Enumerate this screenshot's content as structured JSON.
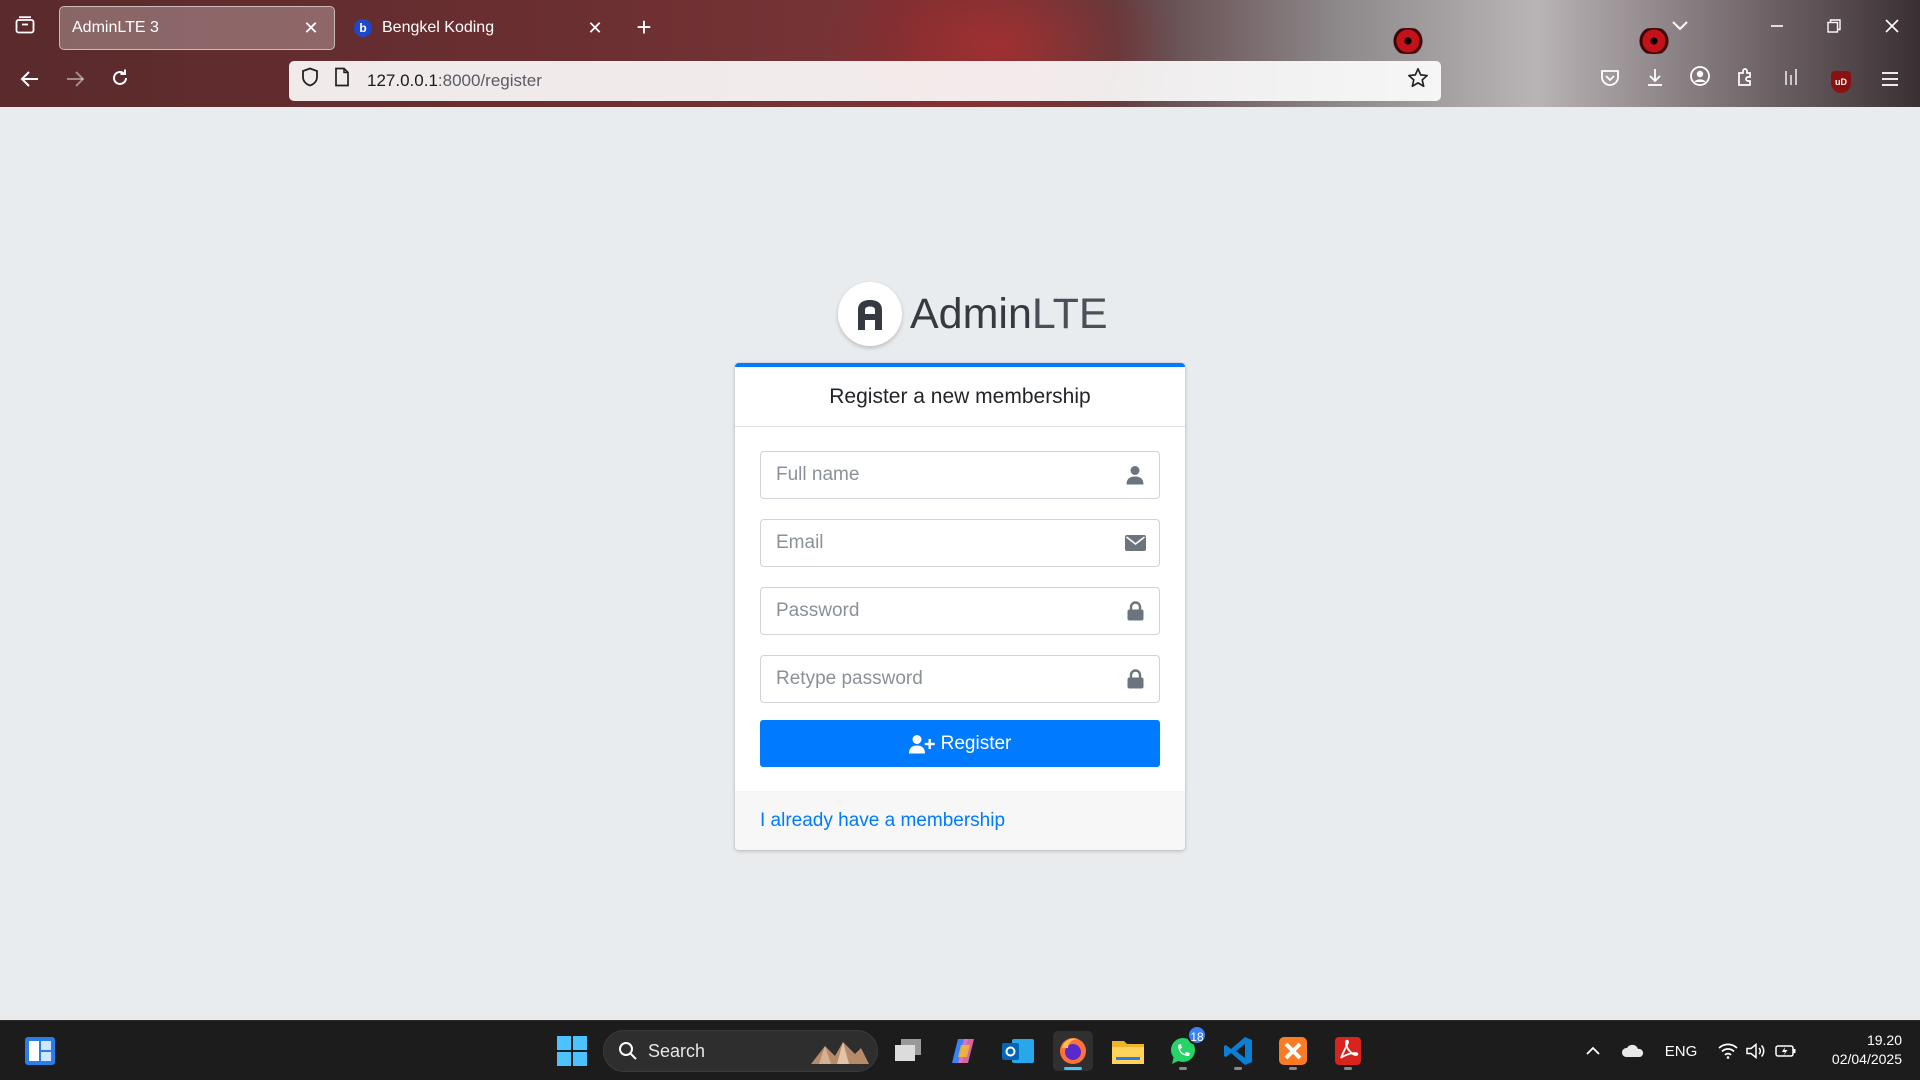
{
  "browser": {
    "tabs": [
      {
        "label": "AdminLTE 3",
        "active": true
      },
      {
        "label": "Bengkel Koding",
        "active": false,
        "favicon": "b"
      }
    ],
    "url_host": "127.0.0.1",
    "url_rest": ":8000/register",
    "icons": {
      "tab_list": "tab-list-icon",
      "close": "close-icon",
      "new_tab": "plus-icon",
      "back": "arrow-left-icon",
      "forward": "arrow-right-icon",
      "reload": "reload-icon",
      "shield": "shield-icon",
      "page": "page-icon",
      "bookmark": "star-icon",
      "pocket": "pocket-icon",
      "downloads": "download-icon",
      "account": "account-icon",
      "extensions": "puzzle-icon",
      "reader": "reader-icon",
      "ublock": "ublock-icon",
      "menu": "hamburger-icon"
    },
    "ublock_label": "uD"
  },
  "brand": {
    "name_bold": "Admin",
    "name_light": "LTE"
  },
  "register": {
    "header": "Register a new membership",
    "fields": [
      {
        "placeholder": "Full name",
        "icon": "user-icon"
      },
      {
        "placeholder": "Email",
        "icon": "envelope-icon"
      },
      {
        "placeholder": "Password",
        "icon": "lock-icon"
      },
      {
        "placeholder": "Retype password",
        "icon": "lock-icon"
      }
    ],
    "submit_label": "Register",
    "submit_icon": "user-plus-icon",
    "login_link": "I already have a membership"
  },
  "colors": {
    "primary": "#007bff",
    "page_bg": "#e9ecef",
    "taskbar_bg": "#1c1c1c"
  },
  "taskbar": {
    "search_label": "Search",
    "apps": [
      "task-view",
      "copilot",
      "outlook",
      "firefox",
      "file-explorer",
      "whatsapp",
      "vscode",
      "xampp",
      "acrobat"
    ],
    "whatsapp_badge": "18",
    "tray_language": "ENG",
    "time": "19.20",
    "date": "02/04/2025"
  }
}
